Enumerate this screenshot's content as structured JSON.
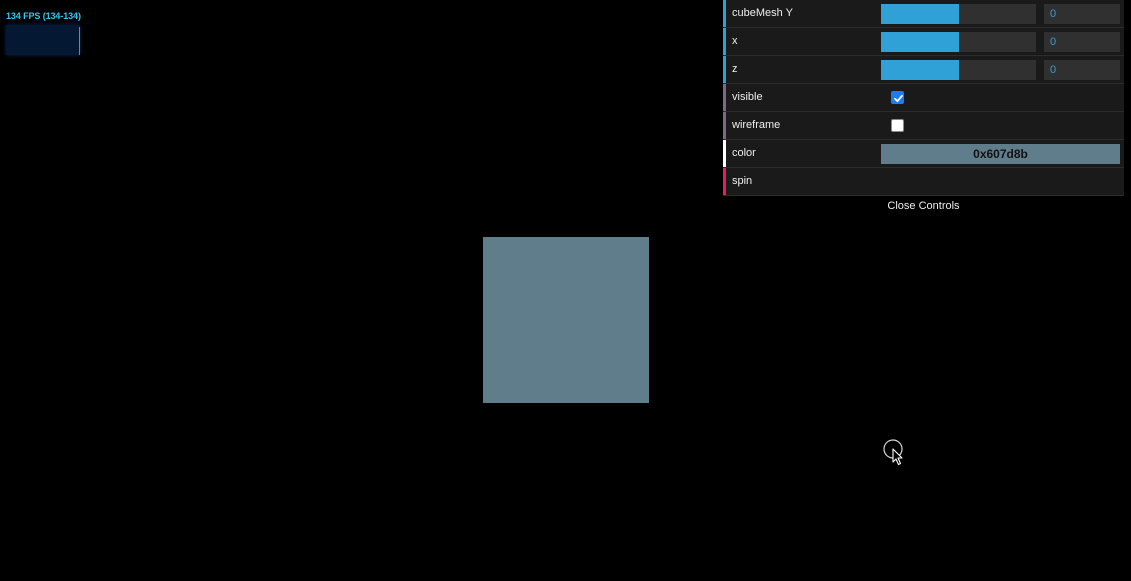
{
  "stats": {
    "fps_label": "134 FPS (134-134)"
  },
  "gui": {
    "rows": [
      {
        "label": "cubeMesh Y",
        "value": "0",
        "fill_fraction": 0.5,
        "stripe_color": "#2fa1d6"
      },
      {
        "label": "x",
        "value": "0",
        "fill_fraction": 0.5,
        "stripe_color": "#2fa1d6"
      },
      {
        "label": "z",
        "value": "0",
        "fill_fraction": 0.5,
        "stripe_color": "#2fa1d6"
      }
    ],
    "visible": {
      "label": "visible",
      "checked": true,
      "stripe_color": "#806787"
    },
    "wireframe": {
      "label": "wireframe",
      "checked": false,
      "stripe_color": "#806787"
    },
    "color": {
      "label": "color",
      "value": "0x607d8b",
      "swatch": "#607d8b",
      "stripe_color": "#ffffff"
    },
    "spin": {
      "label": "spin",
      "stripe_color": "#e61d5f"
    },
    "close_label": "Close Controls"
  },
  "scene": {
    "cube_color": "#607d8b",
    "background": "#000000"
  },
  "colors": {
    "accent": "#2fa1d6",
    "panel_bg": "#1a1a1a",
    "stats_text": "#2ec9f0"
  },
  "icons": {
    "checkmark": "checkmark-icon",
    "cursor": "pointer-cursor-icon"
  }
}
